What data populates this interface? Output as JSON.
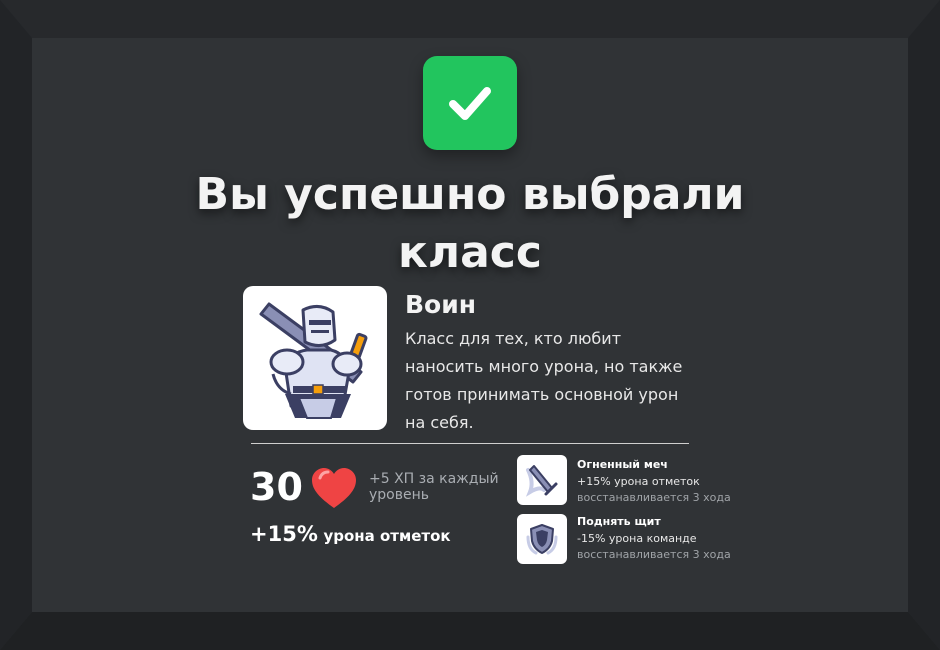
{
  "title": "Вы успешно выбрали класс",
  "class": {
    "name": "Воин",
    "description": "Класс для тех, кто любит наносить много урона, но также готов принимать основной урон на себя.",
    "icon": "knight-icon"
  },
  "stats": {
    "hp": "30",
    "hp_icon": "heart-icon",
    "hp_per_level": "+5 ХП за каждый уровень",
    "bonus_value": "+15%",
    "bonus_label": "урона отметок"
  },
  "skills": [
    {
      "name": "Огненный меч",
      "effect": "+15% урона отметок",
      "cooldown": "восстанавливается 3 хода",
      "icon": "sword-icon"
    },
    {
      "name": "Поднять щит",
      "effect": "-15% урона команде",
      "cooldown": "восстанавливается 3 хода",
      "icon": "shield-icon"
    }
  ],
  "colors": {
    "accent": "#22c55e",
    "background": "#303336",
    "heart": "#ef4444"
  }
}
